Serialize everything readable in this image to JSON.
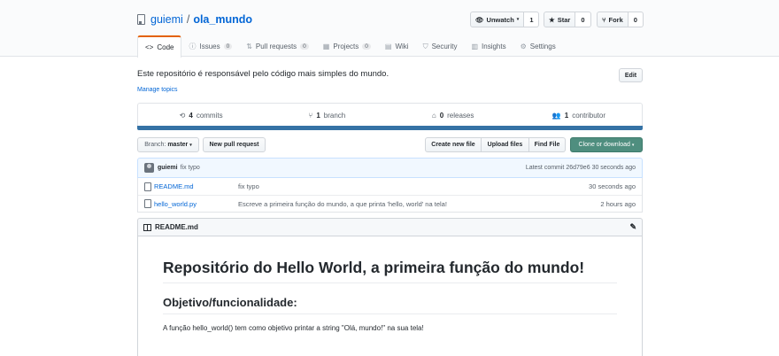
{
  "repo": {
    "owner": "guiemi",
    "separator": "/",
    "name": "ola_mundo"
  },
  "actions": {
    "watch": {
      "label": "Unwatch",
      "count": "1"
    },
    "star": {
      "label": "Star",
      "count": "0"
    },
    "fork": {
      "label": "Fork",
      "count": "0"
    }
  },
  "tabs": [
    {
      "label": "Code",
      "icon": "code-icon"
    },
    {
      "label": "Issues",
      "count": "0",
      "icon": "issue-icon"
    },
    {
      "label": "Pull requests",
      "count": "0",
      "icon": "pull-request-icon"
    },
    {
      "label": "Projects",
      "count": "0",
      "icon": "project-icon"
    },
    {
      "label": "Wiki",
      "icon": "book-icon"
    },
    {
      "label": "Security",
      "icon": "shield-icon"
    },
    {
      "label": "Insights",
      "icon": "graph-icon"
    },
    {
      "label": "Settings",
      "icon": "gear-icon"
    }
  ],
  "description": "Este repositório é responsável pelo código mais simples do mundo.",
  "manage_topics": "Manage topics",
  "edit_label": "Edit",
  "stats": [
    {
      "value": "4",
      "label": "commits"
    },
    {
      "value": "1",
      "label": "branch"
    },
    {
      "value": "0",
      "label": "releases"
    },
    {
      "value": "1",
      "label": "contributor"
    }
  ],
  "language_color": "#3572a5",
  "toolbar": {
    "branch_prefix": "Branch:",
    "branch_name": "master",
    "new_pr": "New pull request",
    "create_file": "Create new file",
    "upload_files": "Upload files",
    "find_file": "Find File",
    "clone": "Clone or download"
  },
  "commit": {
    "author": "guiemi",
    "message": "fix typo",
    "latest_label": "Latest commit",
    "sha": "26d79e6",
    "age": "30 seconds ago"
  },
  "files": [
    {
      "name": "README.md",
      "message": "fix typo",
      "age": "30 seconds ago"
    },
    {
      "name": "hello_world.py",
      "message": "Escreve a primeira função do mundo, a que printa 'hello, world' na tela!",
      "age": "2 hours ago"
    }
  ],
  "readme": {
    "filename": "README.md",
    "h1": "Repositório do Hello World, a primeira função do mundo!",
    "h2": "Objetivo/funcionalidade:",
    "paragraph": "A função hello_world() tem como objetivo printar a string \"Olá, mundo!\" na sua tela!"
  }
}
